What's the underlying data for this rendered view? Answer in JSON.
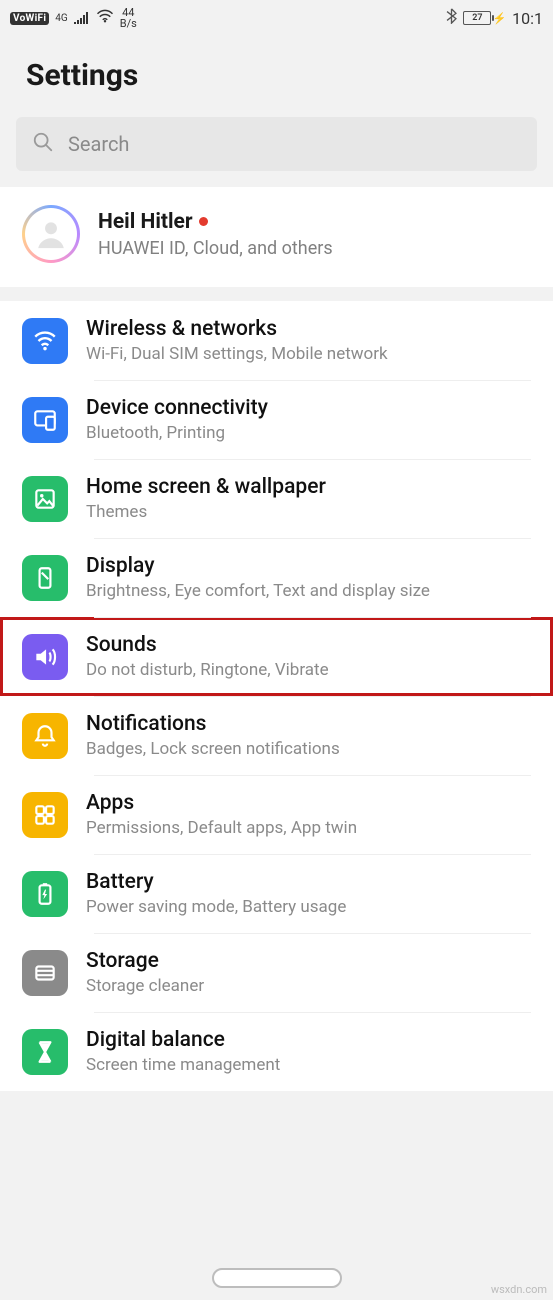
{
  "status": {
    "vowifi": "VoWiFi",
    "net": "4G",
    "netSub": "+",
    "speed_top": "44",
    "speed_bottom": "B/s",
    "battery": "27",
    "time": "10:1"
  },
  "header": {
    "title": "Settings"
  },
  "search": {
    "placeholder": "Search"
  },
  "account": {
    "name": "Heil Hitler",
    "sub": "HUAWEI ID, Cloud, and others"
  },
  "items": [
    {
      "title": "Wireless & networks",
      "sub": "Wi-Fi, Dual SIM settings, Mobile network"
    },
    {
      "title": "Device connectivity",
      "sub": "Bluetooth, Printing"
    },
    {
      "title": "Home screen & wallpaper",
      "sub": "Themes"
    },
    {
      "title": "Display",
      "sub": "Brightness, Eye comfort, Text and display size"
    },
    {
      "title": "Sounds",
      "sub": "Do not disturb, Ringtone, Vibrate"
    },
    {
      "title": "Notifications",
      "sub": "Badges, Lock screen notifications"
    },
    {
      "title": "Apps",
      "sub": "Permissions, Default apps, App twin"
    },
    {
      "title": "Battery",
      "sub": "Power saving mode, Battery usage"
    },
    {
      "title": "Storage",
      "sub": "Storage cleaner"
    },
    {
      "title": "Digital balance",
      "sub": "Screen time management"
    }
  ],
  "watermark": "wsxdn.com"
}
